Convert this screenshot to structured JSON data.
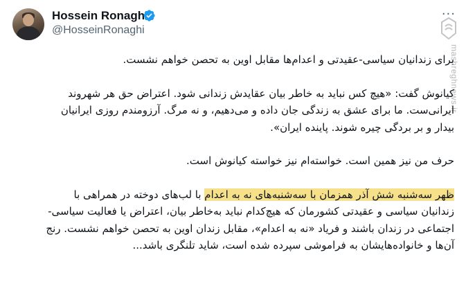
{
  "author": {
    "name": "Hossein Ronaghi",
    "handle": "@HosseinRonaghi",
    "verified_color": "#1d9bf0"
  },
  "more_label": "···",
  "watermark": {
    "text": "mashreghnews.ir"
  },
  "tweet": {
    "line_1": "برای زندانیان سیاسی-عقیدتی و اعدام‌ها مقابل اوین به تحصن خواهم نشست.",
    "para_2": "کیانوش گفت: «هیچ کس نباید به خاطر بیان عقایدش زندانی شود. اعتراض حق هر شهروند ایرانی‌ست. ما برای عشق به زندگی جان داده و می‌دهیم، و نه مرگ. آرزومندم روزی ایرانیان بیدار و بر بردگی چیره شوند. پاینده ایران».",
    "para_3": "حرف من نیز همین است. خواسته‌ام نیز خواسته کیانوش است.",
    "para_4_highlight": "ظهر سه‌شنبه شش آذر همزمان با سه‌شنبه‌های نه به اعدام",
    "para_4_rest": " با لب‌های دوخته در همراهی با زندانیان سیاسی و عقیدتی کشورمان که هیچ‌کدام نباید به‌خاطر بیان، اعتراض یا فعالیت سیاسی-اجتماعی در زندان باشند و فریاد «نه به اعدام»، مقابل زندان اوین به تحصن خواهم نشست. رنج آن‌ها و خانواده‌هایشان به فراموشی سپرده شده است، شاید تلنگری باشد..."
  },
  "colors": {
    "highlight": "#f7e08a",
    "secondary_text": "#536471"
  }
}
